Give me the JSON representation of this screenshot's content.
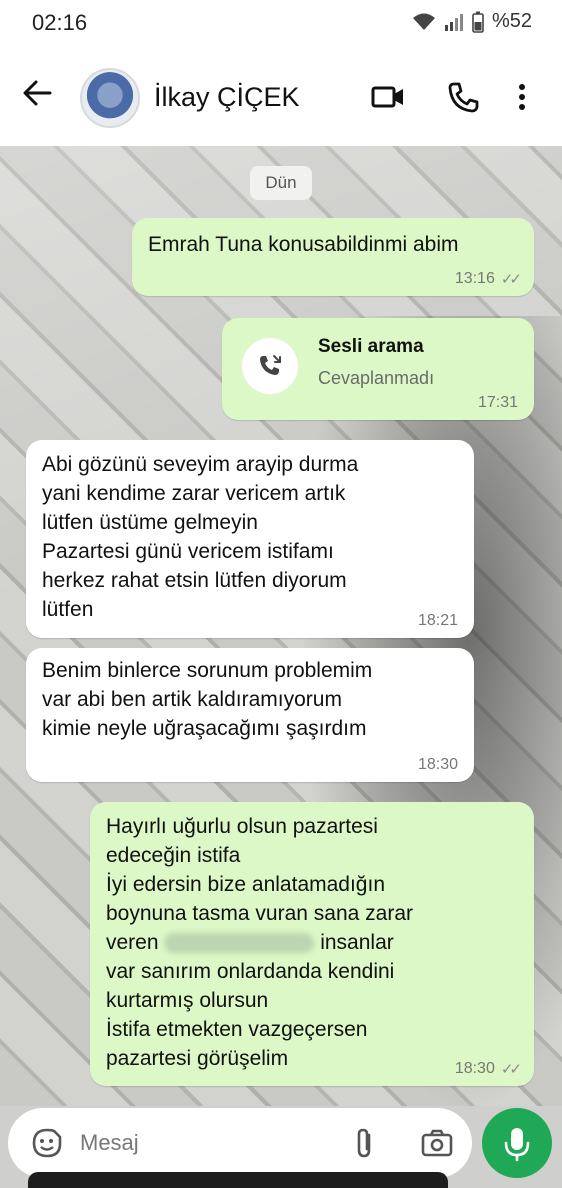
{
  "status_bar": {
    "time": "02:16",
    "battery": "%52"
  },
  "header": {
    "contact_name": "İlkay ÇİÇEK"
  },
  "chat": {
    "date_chip": "Dün",
    "messages": [
      {
        "text": "Emrah Tuna konusabildinmi abim",
        "time": "13:16"
      },
      {
        "call_title": "Sesli arama",
        "call_status": "Cevaplanmadı",
        "time": "17:31"
      },
      {
        "text": "Abi gözünü seveyim arayip durma\nyani kendime zarar vericem artık\nlütfen üstüme gelmeyin\nPazartesi günü vericem istifamı\nherkez rahat etsin lütfen diyorum\nlütfen",
        "time": "18:21"
      },
      {
        "text": "Benim binlerce sorunum problemim\nvar abi ben artik kaldıramıyorum\nkimie neyle uğraşacağımı şaşırdım",
        "time": "18:30"
      },
      {
        "text_before_blur": "Hayırlı uğurlu olsun pazartesi\nedeceğin istifa\nİyi edersin bize anlatamadığın\nboynuna tasma vuran sana zarar\nveren ",
        "text_after_blur": " insanlar\nvar  sanırım onlardanda kendini\nkurtarmış olursun\nİstifa etmekten vazgeçersen\npazartesi görüşelim",
        "time": "18:30"
      }
    ]
  },
  "input": {
    "placeholder": "Mesaj"
  },
  "colors": {
    "outgoing_bubble": "#dcf8c6",
    "incoming_bubble": "#ffffff",
    "mic_button": "#1fa855"
  }
}
